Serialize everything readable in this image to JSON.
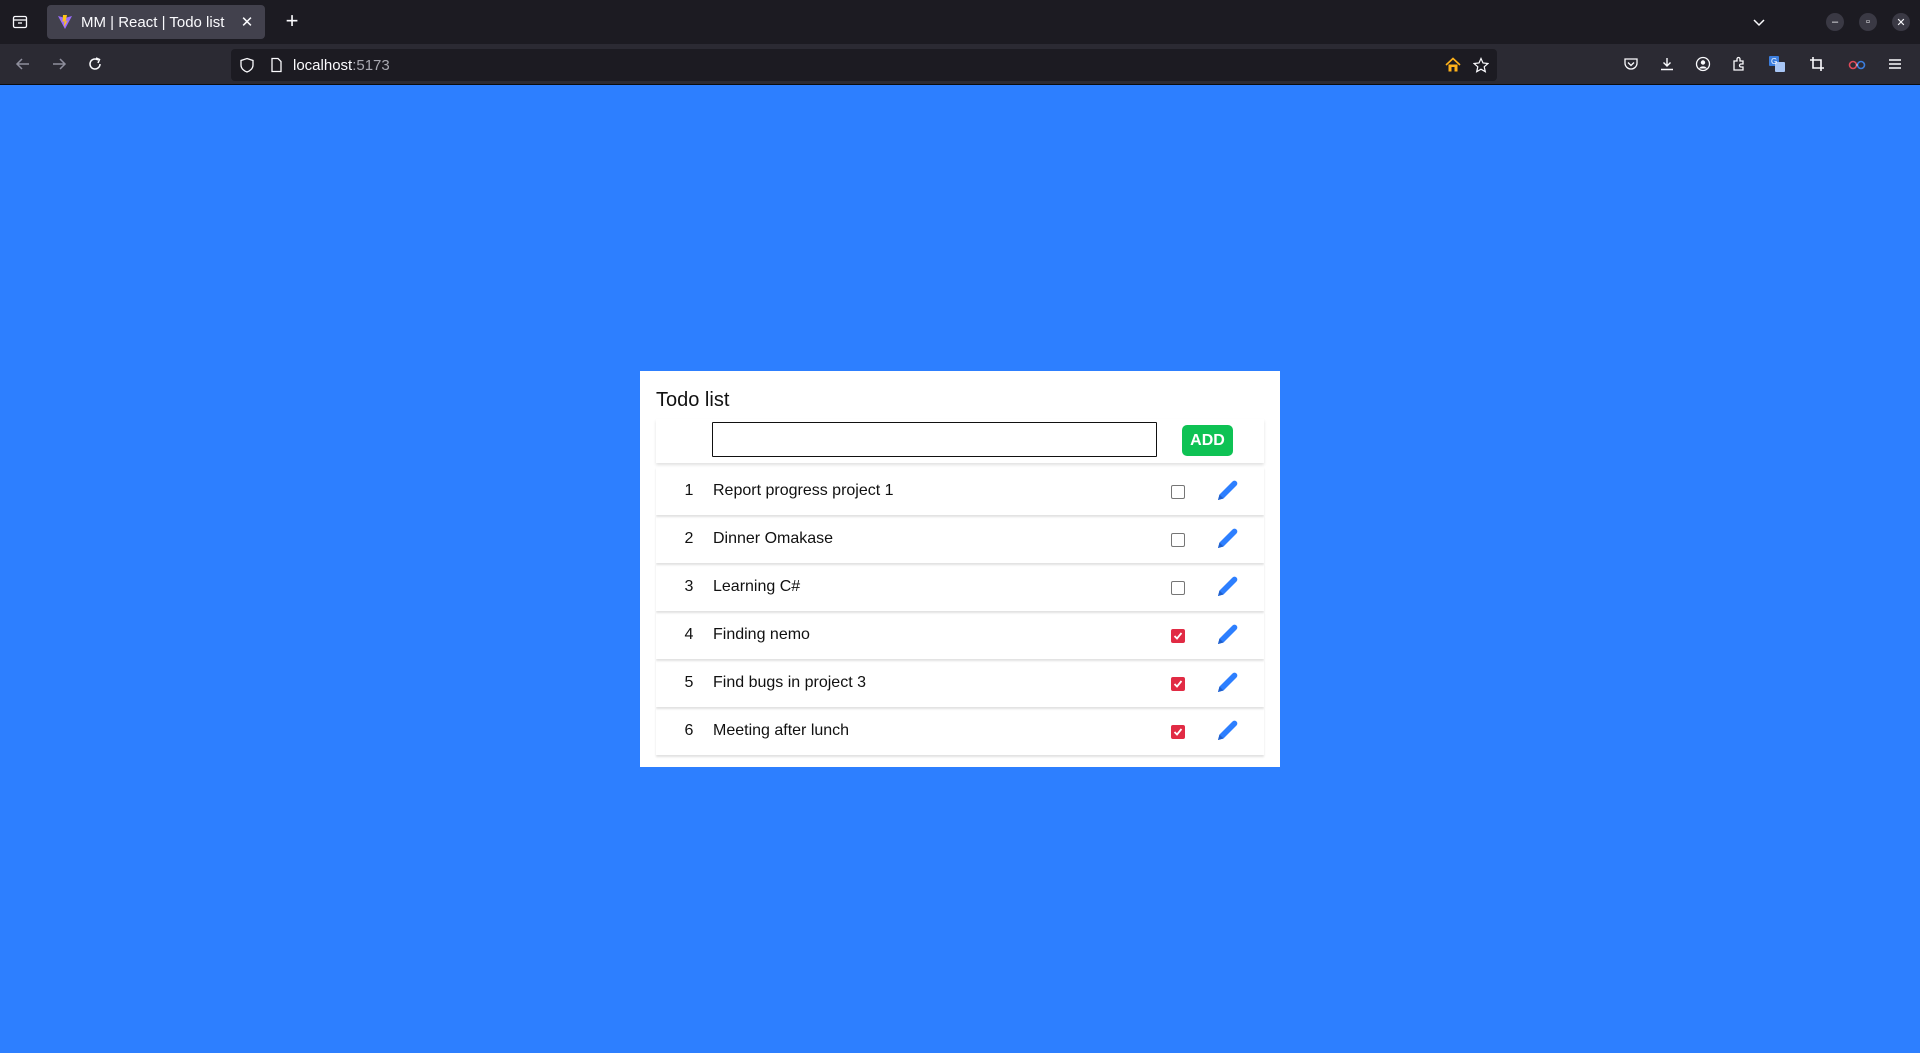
{
  "browser": {
    "tab_title": "MM | React | Todo list",
    "url_host": "localhost",
    "url_port": ":5173"
  },
  "page": {
    "title": "Todo list",
    "input_value": "",
    "add_label": "ADD",
    "todos": [
      {
        "num": "1",
        "text": "Report progress project 1",
        "done": false
      },
      {
        "num": "2",
        "text": "Dinner Omakase",
        "done": false
      },
      {
        "num": "3",
        "text": "Learning C#",
        "done": false
      },
      {
        "num": "4",
        "text": "Finding nemo",
        "done": true
      },
      {
        "num": "5",
        "text": "Find bugs in project 3",
        "done": true
      },
      {
        "num": "6",
        "text": "Meeting after lunch",
        "done": true
      }
    ]
  },
  "colors": {
    "background": "#2d7fff",
    "add_button": "#0ec254",
    "checked": "#e12b44",
    "edit_icon": "#2d7fff"
  },
  "icons": {
    "edit": "pencil-icon"
  }
}
